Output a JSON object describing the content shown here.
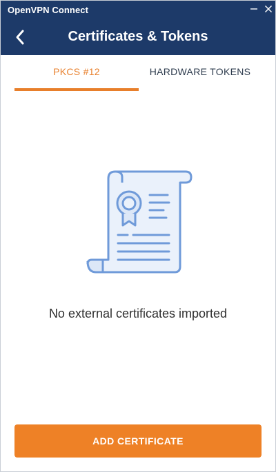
{
  "window": {
    "title": "OpenVPN Connect",
    "minimize_icon": "minimize-icon",
    "close_icon": "close-icon"
  },
  "header": {
    "title": "Certificates & Tokens",
    "back_icon": "chevron-left-icon"
  },
  "tabs": [
    {
      "label": "PKCS #12",
      "active": true
    },
    {
      "label": "HARDWARE TOKENS",
      "active": false
    }
  ],
  "empty_state": {
    "illustration": "certificate-scroll-icon",
    "message": "No external certificates imported"
  },
  "actions": {
    "add_certificate_label": "ADD CERTIFICATE"
  },
  "colors": {
    "header_bg": "#1d3a69",
    "accent": "#ee8126",
    "active_tab": "#e87f2b",
    "illustration_stroke": "#6f9ad9",
    "illustration_fill": "#eaf1fb"
  }
}
